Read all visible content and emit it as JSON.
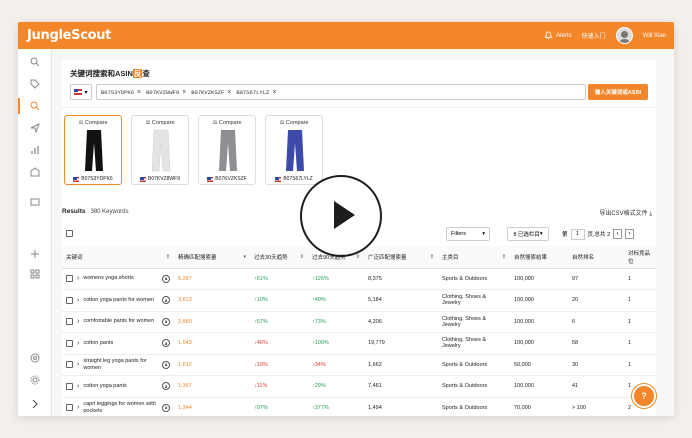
{
  "app": {
    "logo": "JungleScout"
  },
  "topbar": {
    "alerts": "Alerts",
    "guide": "快速入门",
    "user": "Will Xiao"
  },
  "search": {
    "title_prefix": "关键词搜索和ASIN",
    "title_highlight": "反",
    "title_suffix": "查",
    "asins": [
      "B07S3YDPK6",
      "B07KVZ8WF9",
      "B07KVZKSZF",
      "B07S67LYLZ"
    ],
    "button": "输入关键词或ASIN"
  },
  "products": [
    {
      "compare": "Compare",
      "asin": "B07S3YDPK6",
      "color": "#111111"
    },
    {
      "compare": "Compare",
      "asin": "B07KVZ8WF9",
      "color": "#e9e9ea"
    },
    {
      "compare": "Compare",
      "asin": "B07KVZKSZF",
      "color": "#8d8f92"
    },
    {
      "compare": "Compare",
      "asin": "B07S67LYLZ",
      "color": "#3d4aa8"
    }
  ],
  "results": {
    "label": "Results",
    "count": "380 Keywords",
    "export": "导出CSV格式文件"
  },
  "toolbar": {
    "filters": "Filters",
    "columns": "8 已选栏目",
    "page_prefix": "第",
    "page": "1",
    "page_suffix": "页,总共 2"
  },
  "columns": [
    "关键词",
    "精确匹配搜索量",
    "过去30天趋势",
    "过去90天趋势",
    "广泛匹配搜索量",
    "主类目",
    "自然搜索结果",
    "自然排名",
    "对标竞品位"
  ],
  "rows": [
    {
      "keyword": "womens yoga shorts",
      "exact": "5,287",
      "t30": "61%",
      "t30dir": "up",
      "t90": "126%",
      "t90dir": "up",
      "broad": "8,375",
      "category": "Sports & Outdoors",
      "organic": "100,000",
      "rank": "97",
      "comp": "1"
    },
    {
      "keyword": "cotton yoga pants for women",
      "exact": "3,613",
      "t30": "10%",
      "t30dir": "up",
      "t90": "40%",
      "t90dir": "up",
      "broad": "5,184",
      "category": "Clothing, Shoes & Jewelry",
      "organic": "100,000",
      "rank": "20",
      "comp": "1"
    },
    {
      "keyword": "comfortable pants for women",
      "exact": "2,880",
      "t30": "57%",
      "t30dir": "up",
      "t90": "73%",
      "t90dir": "up",
      "broad": "4,206",
      "category": "Clothing, Shoes & Jewelry",
      "organic": "100,000",
      "rank": "6",
      "comp": "1"
    },
    {
      "keyword": "cotton pants",
      "exact": "1,543",
      "t30": "46%",
      "t30dir": "down",
      "t90": "100%",
      "t90dir": "up",
      "broad": "19,779",
      "category": "Clothing, Shoes & Jewelry",
      "organic": "100,000",
      "rank": "58",
      "comp": "1"
    },
    {
      "keyword": "straight leg yoga pants for women",
      "exact": "1,812",
      "t30": "10%",
      "t30dir": "down",
      "t90": "34%",
      "t90dir": "down",
      "broad": "1,662",
      "category": "Sports & Outdoors",
      "organic": "50,000",
      "rank": "30",
      "comp": "1"
    },
    {
      "keyword": "cotton yoga pants",
      "exact": "1,367",
      "t30": "11%",
      "t30dir": "down",
      "t90": "29%",
      "t90dir": "up",
      "broad": "7,461",
      "category": "Sports & Outdoors",
      "organic": "100,000",
      "rank": "41",
      "comp": "1"
    },
    {
      "keyword": "capri leggings for women with pockets",
      "exact": "1,344",
      "t30": "97%",
      "t30dir": "up",
      "t90": "377%",
      "t90dir": "up",
      "broad": "1,494",
      "category": "Sports & Outdoors",
      "organic": "70,000",
      "rank": "> 100",
      "comp": "2"
    }
  ]
}
